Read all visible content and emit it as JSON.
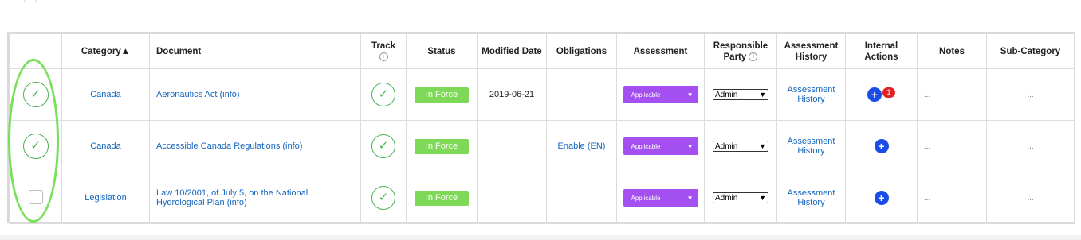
{
  "header": {
    "category": "Category",
    "sort_indicator": "▲",
    "document": "Document",
    "track": "Track",
    "status": "Status",
    "modified_date": "Modified Date",
    "obligations": "Obligations",
    "assessment": "Assessment",
    "responsible_party_line1": "Responsible",
    "responsible_party_line2": "Party",
    "assessment_history_line1": "Assessment",
    "assessment_history_line2": "History",
    "internal_actions_line1": "Internal",
    "internal_actions_line2": "Actions",
    "notes": "Notes",
    "sub_category": "Sub-Category"
  },
  "info_glyph": "i",
  "rows": [
    {
      "selected": true,
      "category": "Canada",
      "document": "Aeronautics Act (info)",
      "status": "In Force",
      "modified_date": "2019-06-21",
      "obligations": "",
      "assessment": "Applicable",
      "responsible_party": "Admin",
      "history_line1": "Assessment",
      "history_line2": "History",
      "action_count": "1",
      "notes": "...",
      "sub_category": "..."
    },
    {
      "selected": true,
      "category": "Canada",
      "document": "Accessible Canada Regulations (info)",
      "status": "In Force",
      "modified_date": "",
      "obligations": "Enable (EN)",
      "assessment": "Applicable",
      "responsible_party": "Admin",
      "history_line1": "Assessment",
      "history_line2": "History",
      "action_count": "",
      "notes": "...",
      "sub_category": "..."
    },
    {
      "selected": false,
      "category": "Legislation",
      "document_line1": "Law 10/2001, of July 5, on the National",
      "document_line2": "Hydrological Plan (info)",
      "status": "In Force",
      "modified_date": "",
      "obligations": "",
      "assessment": "Applicable",
      "responsible_party": "Admin",
      "history_line1": "Assessment",
      "history_line2": "History",
      "action_count": "",
      "notes": "...",
      "sub_category": "..."
    }
  ],
  "glyphs": {
    "check": "✓",
    "plus": "+",
    "caret_down": "▼"
  },
  "colors": {
    "status_green": "#7ed957",
    "assessment_purple": "#a450f0",
    "action_blue": "#1a4de8",
    "badge_red": "#e02424",
    "highlight_green": "#77e05a",
    "link_blue": "#1565c0"
  }
}
